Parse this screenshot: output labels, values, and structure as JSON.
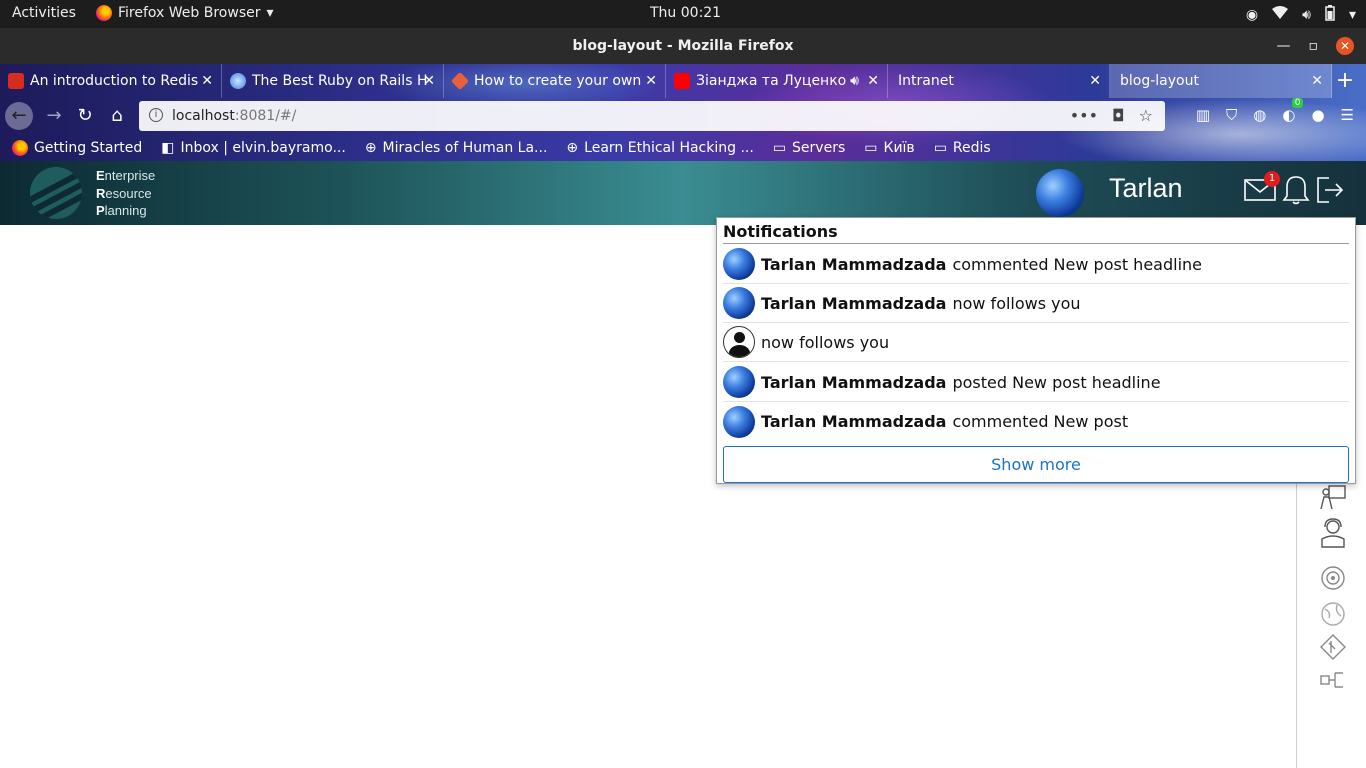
{
  "system_bar": {
    "activities": "Activities",
    "app_name": "Firefox Web Browser",
    "clock": "Thu 00:21"
  },
  "window": {
    "title": "blog-layout - Mozilla Firefox"
  },
  "tabs": [
    {
      "label": "An introduction to Redis"
    },
    {
      "label": "The Best Ruby on Rails H"
    },
    {
      "label": "How to create your own"
    },
    {
      "label": "Зіанджа та Луценко"
    },
    {
      "label": "Intranet"
    },
    {
      "label": "blog-layout"
    }
  ],
  "urlbar": {
    "host": "localhost",
    "rest": ":8081/#/"
  },
  "toolbar_badge": "0",
  "bookmarks": [
    {
      "label": "Getting Started"
    },
    {
      "label": "Inbox | elvin.bayramo..."
    },
    {
      "label": "Miracles of Human La..."
    },
    {
      "label": "Learn Ethical Hacking ..."
    },
    {
      "label": "Servers"
    },
    {
      "label": "Київ"
    },
    {
      "label": "Redis"
    }
  ],
  "app_header": {
    "logo_lines": [
      {
        "first": "E",
        "rest": "nterprise"
      },
      {
        "first": "R",
        "rest": "esource"
      },
      {
        "first": "P",
        "rest": "lanning"
      }
    ],
    "username": "Tarlan",
    "mail_badge": "1"
  },
  "notifications": {
    "title": "Notifications",
    "items": [
      {
        "name": "Tarlan Mammadzada",
        "text": "commented New post headline",
        "avatar": "globe"
      },
      {
        "name": "Tarlan Mammadzada",
        "text": "now follows you",
        "avatar": "globe"
      },
      {
        "name": "",
        "text": "now follows you",
        "avatar": "person"
      },
      {
        "name": "Tarlan Mammadzada",
        "text": "posted New post headline",
        "avatar": "globe"
      },
      {
        "name": "Tarlan Mammadzada",
        "text": "commented New post",
        "avatar": "globe"
      }
    ],
    "show_more": "Show more"
  },
  "colors": {
    "accent": "#1a73c8",
    "badge": "#e21b1b",
    "header_teal": "#3a8d92"
  }
}
